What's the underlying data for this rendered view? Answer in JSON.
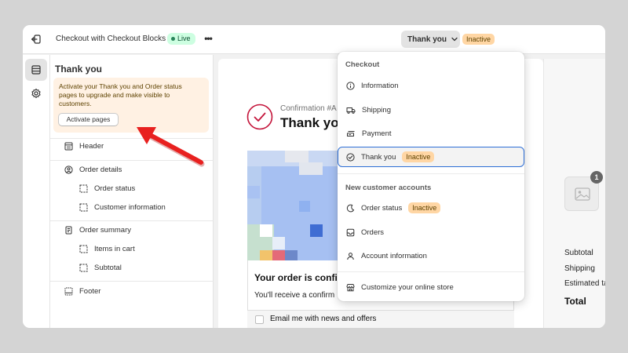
{
  "topbar": {
    "title": "Checkout with Checkout Blocks",
    "live_badge": "Live",
    "page_select_label": "Thank you",
    "page_status": "Inactive"
  },
  "sidebar": {
    "title": "Thank you",
    "banner_text": "Activate your Thank you and Order status pages to upgrade and make visible to customers.",
    "activate_button": "Activate pages",
    "sections": [
      {
        "label": "Header"
      },
      {
        "label": "Order details",
        "children": [
          {
            "label": "Order status"
          },
          {
            "label": "Customer information"
          }
        ]
      },
      {
        "label": "Order summary",
        "children": [
          {
            "label": "Items in cart"
          },
          {
            "label": "Subtotal"
          }
        ]
      },
      {
        "label": "Footer"
      }
    ]
  },
  "preview": {
    "confirmation_number": "Confirmation #A",
    "heading": "Thank you",
    "order_confirmed": "Your order is confir",
    "order_sub": "You'll receive a confirm",
    "newsletter_label": "Email me with news and offers"
  },
  "summary": {
    "quantity": "1",
    "subtotal_label": "Subtotal",
    "shipping_label": "Shipping",
    "estimated_label": "Estimated ta",
    "total_label": "Total"
  },
  "menu": {
    "checkout_heading": "Checkout",
    "checkout_items": [
      {
        "label": "Information",
        "icon": "info-icon"
      },
      {
        "label": "Shipping",
        "icon": "truck-icon"
      },
      {
        "label": "Payment",
        "icon": "cash-icon"
      },
      {
        "label": "Thank you",
        "icon": "check-circle-icon",
        "badge": "Inactive",
        "selected": true
      }
    ],
    "accounts_heading": "New customer accounts",
    "account_items": [
      {
        "label": "Order status",
        "icon": "moon-icon",
        "badge": "Inactive"
      },
      {
        "label": "Orders",
        "icon": "inbox-icon"
      },
      {
        "label": "Account information",
        "icon": "person-icon"
      }
    ],
    "customize_label": "Customize your online store"
  },
  "colors": {
    "accent_blue": "#2d6ed6",
    "live_green": "#cdfee1",
    "inactive_orange": "#ffd6a4",
    "banner_bg": "#fff1e3",
    "arrow_red": "#e8201f",
    "check_red": "#c4153b"
  }
}
